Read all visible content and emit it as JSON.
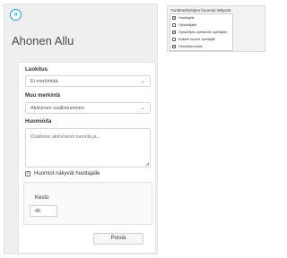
{
  "student": {
    "name": "Ahonen Allu"
  },
  "nav": {
    "icon": "double-chevron-right-icon",
    "glyph": "»"
  },
  "form": {
    "classification": {
      "label": "Luokitus",
      "value": "Ei merkintää"
    },
    "other_mark": {
      "label": "Muu merkintä",
      "value": "Aktiivinen osallistuminen"
    },
    "notes": {
      "label": "Huomioita",
      "value": "Osallistui aktiivisesti tunnilla ja..."
    },
    "visible_to_guardian": {
      "label": "Huomiot näkyvät huoltajalle",
      "checked": true
    },
    "duration": {
      "label": "Kesto",
      "value": "45"
    },
    "delete_label": "Poista"
  },
  "visibility": {
    "title": "Tuntimerkintöjen huomiot näkyvät",
    "options": [
      {
        "label": "Huoltajalle",
        "checked": true
      },
      {
        "label": "Opiskelijalle",
        "checked": false
      },
      {
        "label": "Opiskelijaa opettaville opettajille",
        "checked": true
      },
      {
        "label": "Kaikille koulun opettajille",
        "checked": false
      },
      {
        "label": "Henkilökunnalle",
        "checked": true
      }
    ]
  },
  "colors": {
    "accent": "#1b9ad6"
  }
}
